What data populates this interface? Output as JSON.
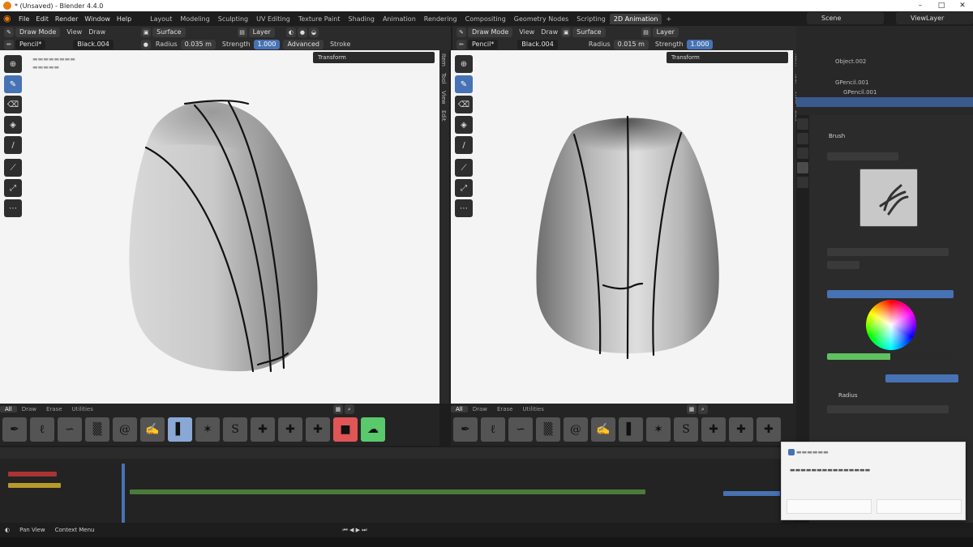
{
  "window": {
    "title": "* (Unsaved) - Blender 4.4.0",
    "minimize": "–",
    "maximize": "□",
    "close": "✕"
  },
  "menu": [
    "File",
    "Edit",
    "Render",
    "Window",
    "Help"
  ],
  "workspaces": [
    "Layout",
    "Modeling",
    "Sculpting",
    "UV Editing",
    "Texture Paint",
    "Shading",
    "Animation",
    "Rendering",
    "Compositing",
    "Geometry Nodes",
    "Scripting",
    "2D Animation"
  ],
  "active_workspace": "2D Animation",
  "add_workspace": "+",
  "scene": "Scene",
  "view_layer": "ViewLayer",
  "left_viewport": {
    "mode": "Draw Mode",
    "view": "View",
    "draw": "Draw",
    "placement": "Surface",
    "layer": "Layer",
    "brush": "Pencil*",
    "material": "Black.004",
    "radius_label": "Radius",
    "radius_value": "0.035 m",
    "strength_label": "Strength",
    "strength_value": "1.000",
    "advanced": "Advanced",
    "stroke": "Stroke",
    "transform": "Transform",
    "sidetabs": [
      "Item",
      "Tool",
      "View",
      "Edit"
    ]
  },
  "right_viewport": {
    "mode": "Draw Mode",
    "view": "View",
    "draw": "Draw",
    "placement": "Surface",
    "layer": "Layer",
    "brush": "Pencil*",
    "material": "Black.004",
    "radius_label": "Radius",
    "radius_value": "0.015 m",
    "strength_label": "Strength",
    "strength_value": "1.000",
    "transform": "Transform",
    "sidetabs": [
      "Item",
      "Tool",
      "View",
      "Edit"
    ]
  },
  "shelf_tabs": [
    "All",
    "Draw",
    "Erase",
    "Utilities"
  ],
  "outliner": {
    "rows": [
      "Object.002",
      "GPencil.001",
      "GPencil.001"
    ]
  },
  "properties": {
    "brush_header": "Brush",
    "radius_label": "Radius"
  },
  "statusbar": {
    "pan": "Pan View",
    "context": "Context Menu"
  }
}
